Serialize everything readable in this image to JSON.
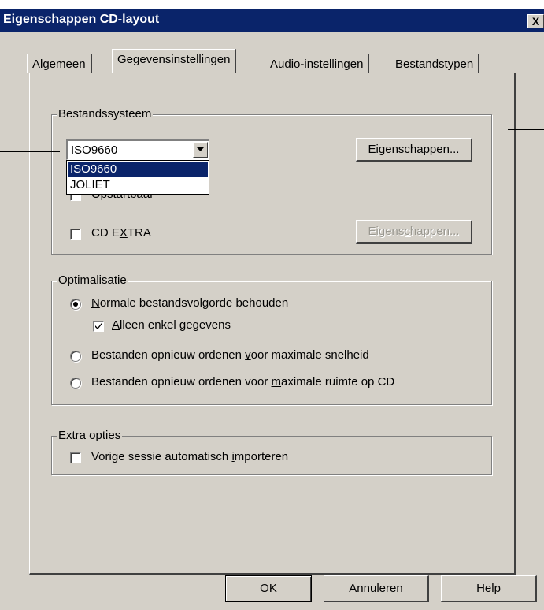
{
  "window": {
    "title": "Eigenschappen CD-layout",
    "close_label": "X"
  },
  "tabs": [
    {
      "label": "Algemeen"
    },
    {
      "label": "Gegevensinstellingen"
    },
    {
      "label": "Audio-instellingen"
    },
    {
      "label": "Bestandstypen"
    }
  ],
  "filesystem": {
    "group_label": "Bestandssysteem",
    "combo_value": "ISO9660",
    "dropdown_options": [
      "ISO9660",
      "JOLIET"
    ],
    "properties_button": {
      "pre": "",
      "key": "E",
      "post": "igenschappen..."
    },
    "hidden_checkbox_fragment": "Opstartbaar",
    "cd_extra": {
      "pre": "CD E",
      "key": "X",
      "post": "TRA"
    },
    "cd_extra_checked": false,
    "properties_button_2": {
      "pre": "Eigens",
      "key": "c",
      "post": "happen..."
    }
  },
  "optimization": {
    "group_label": "Optimalisatie",
    "option1": {
      "pre": "",
      "key": "N",
      "post": "ormale bestandsvolgorde behouden"
    },
    "option1_selected": true,
    "sub_check": {
      "pre": "",
      "key": "A",
      "post": "lleen enkel gegevens"
    },
    "sub_check_checked": true,
    "option2": {
      "pre": "Bestanden opnieuw ordenen ",
      "key": "v",
      "post": "oor maximale snelheid"
    },
    "option3": {
      "pre": "Bestanden opnieuw ordenen voor ",
      "key": "m",
      "post": "aximale ruimte op CD"
    }
  },
  "extra": {
    "group_label": "Extra opties",
    "auto_import": {
      "pre": "Vorige sessie automatisch ",
      "key": "i",
      "post": "mporteren"
    },
    "auto_import_checked": false
  },
  "buttons": {
    "ok": "OK",
    "cancel": "Annuleren",
    "help": "Help"
  },
  "colors": {
    "titlebar": "#0a246a",
    "face": "#d4d0c8",
    "highlight": "#0a246a"
  }
}
